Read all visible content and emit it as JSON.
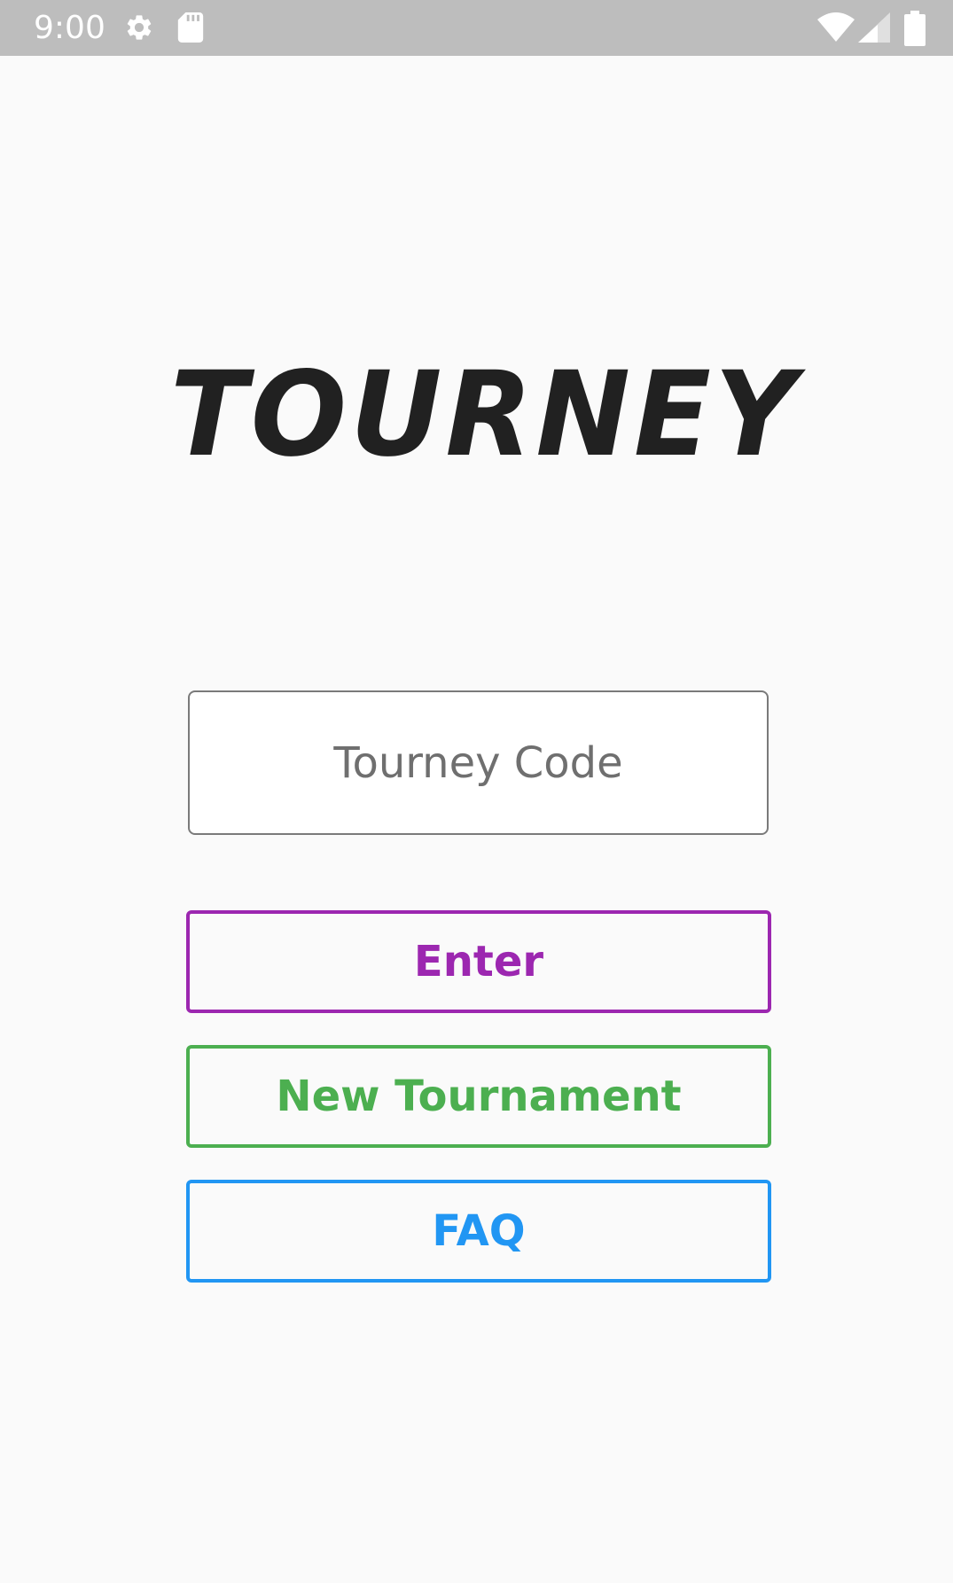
{
  "status_bar": {
    "time": "9:00",
    "icons": [
      "gear-icon",
      "sd-card-icon",
      "wifi-icon",
      "signal-icon",
      "battery-icon"
    ]
  },
  "app": {
    "logo_text": "TOURNEY"
  },
  "code_field": {
    "placeholder": "Tourney Code",
    "value": ""
  },
  "buttons": {
    "enter_label": "Enter",
    "new_tournament_label": "New Tournament",
    "faq_label": "FAQ"
  },
  "colors": {
    "background": "#fafafa",
    "status_bar": "#bdbdbd",
    "enter": "#9c27b0",
    "new_tournament": "#4caf50",
    "faq": "#2196f3"
  }
}
